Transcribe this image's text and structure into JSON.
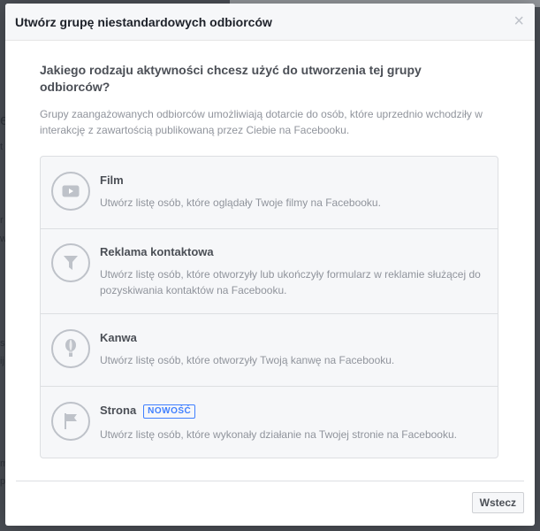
{
  "dialog": {
    "title": "Utwórz grupę niestandardowych odbiorców",
    "close_label": "×",
    "question": "Jakiego rodzaju aktywności chcesz użyć do utworzenia tej grupy odbiorców?",
    "intro": "Grupy zaangażowanych odbiorców umożliwiają dotarcie do osób, które uprzednio wchodziły w interakcję z zawartością publikowaną przez Ciebie na Facebooku.",
    "options": [
      {
        "title": "Film",
        "description": "Utwórz listę osób, które oglądały Twoje filmy na Facebooku.",
        "icon": "video-play-icon"
      },
      {
        "title": "Reklama kontaktowa",
        "description": "Utwórz listę osób, które otworzyły lub ukończyły formularz w reklamie służącej do pozyskiwania kontaktów na Facebooku.",
        "icon": "funnel-icon"
      },
      {
        "title": "Kanwa",
        "description": "Utwórz listę osób, które otworzyły Twoją kanwę na Facebooku.",
        "icon": "balloon-icon"
      },
      {
        "title": "Strona",
        "badge": "NOWOŚĆ",
        "description": "Utwórz listę osób, które wykonały działanie na Twojej stronie na Facebooku.",
        "icon": "flag-icon"
      }
    ],
    "back_button": "Wstecz"
  },
  "background_fragments": [
    "e",
    "t",
    "r",
    "w",
    "s",
    "ij",
    "m",
    "p"
  ],
  "colors": {
    "accent": "#4080ff",
    "text": "#4b4f56",
    "muted": "#90949c",
    "border": "#dddfe2"
  }
}
